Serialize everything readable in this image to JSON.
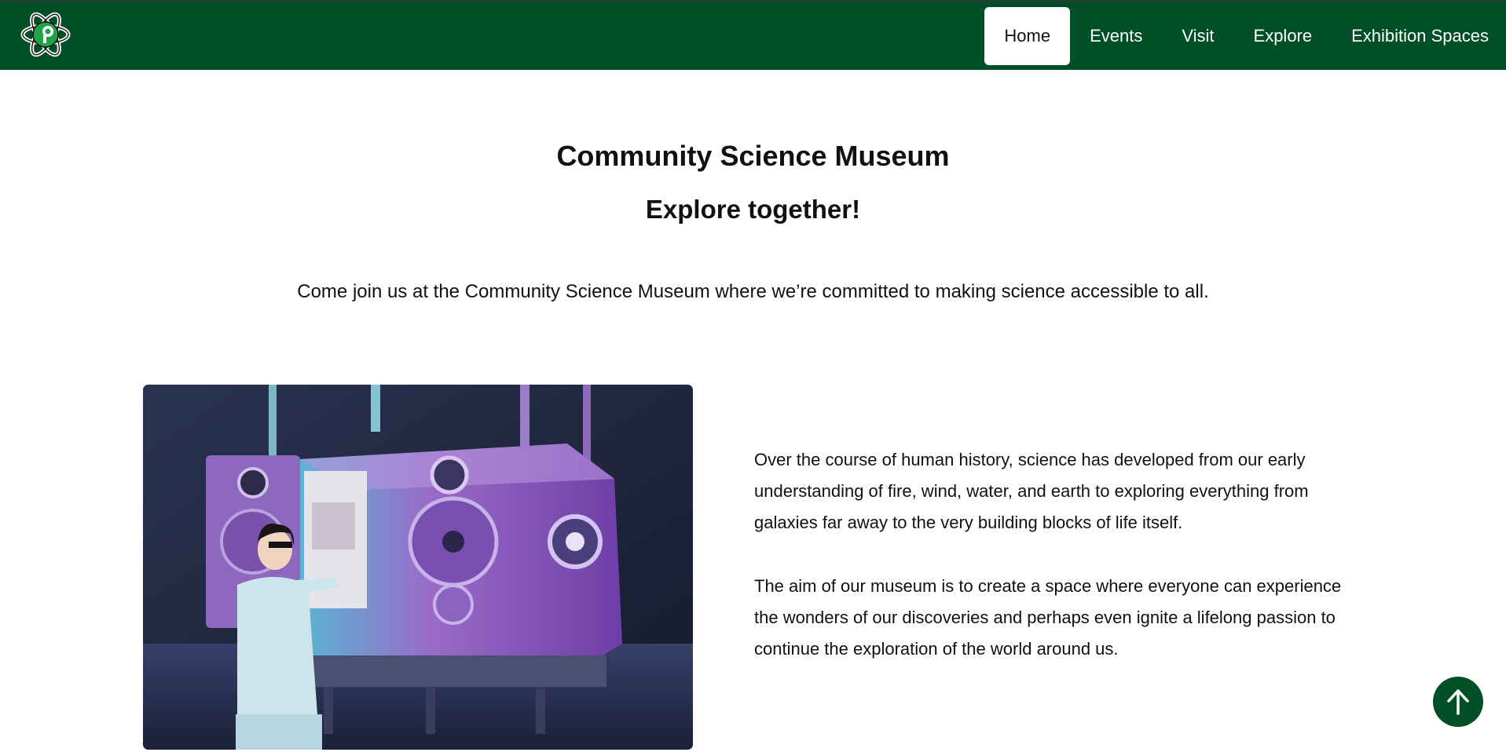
{
  "header": {
    "logo_icon": "atom-science-logo",
    "nav": [
      {
        "label": "Home",
        "active": true
      },
      {
        "label": "Events",
        "active": false
      },
      {
        "label": "Visit",
        "active": false
      },
      {
        "label": "Explore",
        "active": false
      },
      {
        "label": "Exhibition Spaces",
        "active": false
      }
    ]
  },
  "hero": {
    "title": "Community Science Museum",
    "subtitle": "Explore together!",
    "intro": "Come join us at the Community Science Museum where we’re committed to making science accessible to all."
  },
  "about": {
    "image_icon": "lab-vacuum-chamber-photo",
    "paragraphs": [
      "Over the course of human history, science has developed from our early understanding of fire, wind, water, and earth to exploring everything from galaxies far away to the very building blocks of life itself.",
      "The aim of our museum is to create a space where everyone can experience the wonders of our discoveries and perhaps even ignite a lifelong passion to continue the exploration of the world around us."
    ]
  },
  "back_to_top": {
    "icon": "arrow-up-icon"
  },
  "colors": {
    "brand_green": "#004f26",
    "accent_green": "#1fa34a",
    "text": "#111111",
    "background": "#ffffff"
  }
}
